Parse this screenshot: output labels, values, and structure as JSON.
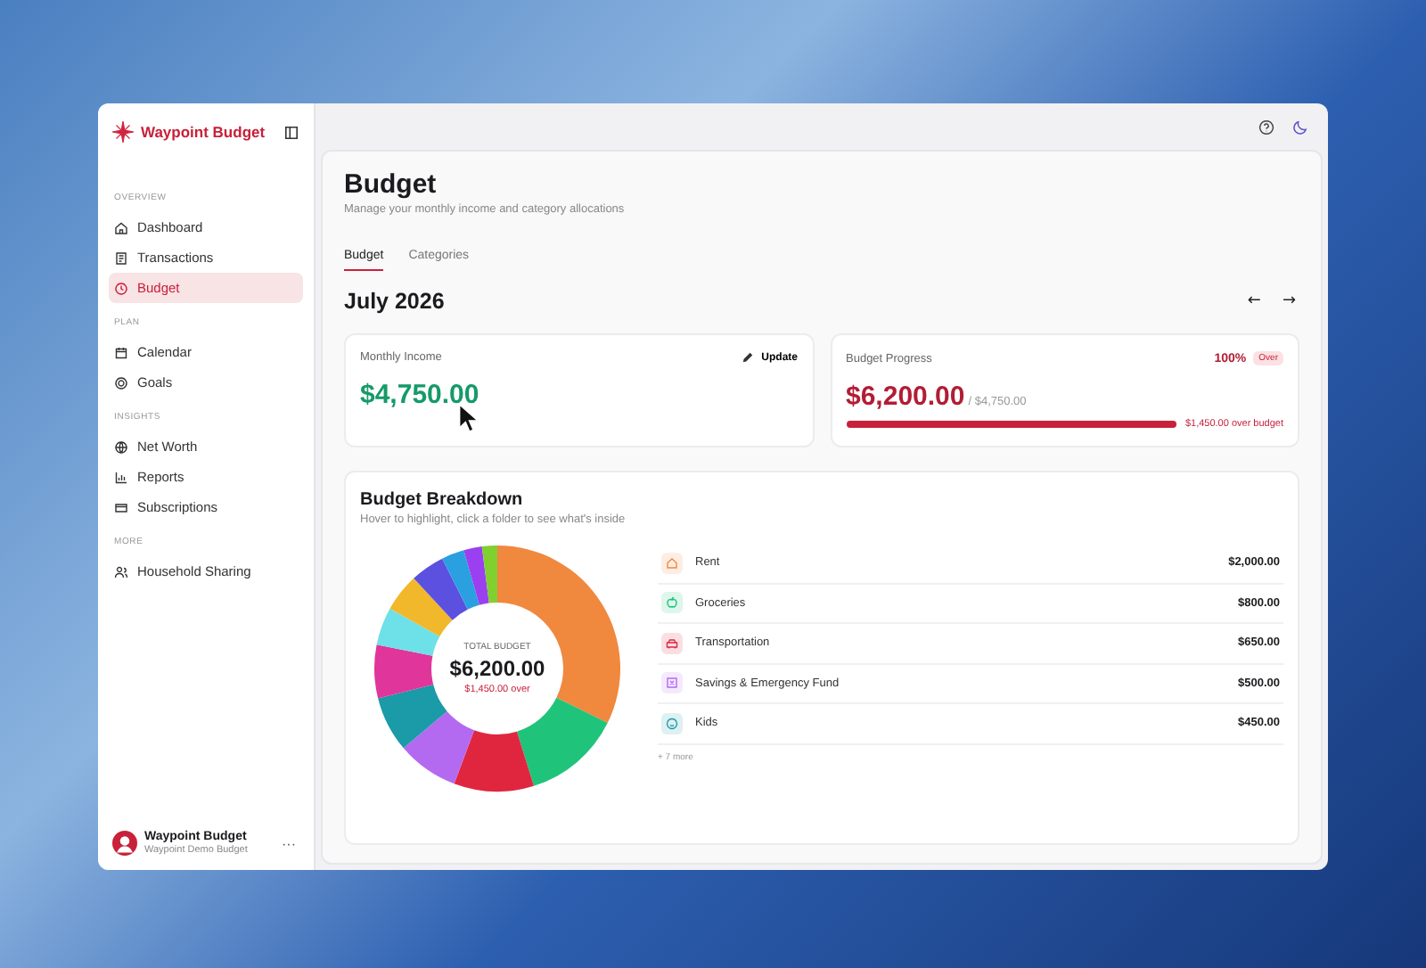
{
  "app": {
    "name": "Waypoint Budget"
  },
  "sidebar": {
    "sections": [
      {
        "heading": "OVERVIEW",
        "items": [
          {
            "label": "Dashboard",
            "selected": false
          },
          {
            "label": "Transactions",
            "selected": false
          },
          {
            "label": "Budget",
            "selected": true
          }
        ]
      },
      {
        "heading": "PLAN",
        "items": [
          {
            "label": "Calendar",
            "selected": false
          },
          {
            "label": "Goals",
            "selected": false
          }
        ]
      },
      {
        "heading": "INSIGHTS",
        "items": [
          {
            "label": "Net Worth",
            "selected": false
          },
          {
            "label": "Reports",
            "selected": false
          },
          {
            "label": "Subscriptions",
            "selected": false
          }
        ]
      },
      {
        "heading": "MORE",
        "items": [
          {
            "label": "Household Sharing",
            "selected": false
          }
        ]
      }
    ]
  },
  "account": {
    "name": "Waypoint Budget",
    "subtitle": "Waypoint Demo Budget",
    "menu": "···"
  },
  "page": {
    "title": "Budget",
    "subtitle": "Manage your monthly income and category allocations"
  },
  "tabs": [
    {
      "label": "Budget",
      "selected": true
    },
    {
      "label": "Categories",
      "selected": false
    }
  ],
  "month": {
    "label": "July 2026",
    "prev": "←",
    "next": "→"
  },
  "income_card": {
    "label": "Monthly Income",
    "button": "Update",
    "amount": "$4,750.00"
  },
  "progress_card": {
    "label": "Budget Progress",
    "percent": "100%",
    "badge": "Over",
    "spent": "$6,200.00",
    "of": "/ $4,750.00",
    "level": 1,
    "note": "$1,450.00 over budget"
  },
  "breakdown": {
    "title": "Budget Breakdown",
    "subtitle": "Hover to highlight, click a folder to see what's inside",
    "center_label": "TOTAL BUDGET",
    "center_amount": "$6,200.00",
    "center_note": "$1,450.00 over",
    "categories": [
      {
        "name": "Rent",
        "amount": "$2,000.00",
        "color": "#f0883e"
      },
      {
        "name": "Groceries",
        "amount": "$800.00",
        "color": "#1fc47a"
      },
      {
        "name": "Transportation",
        "amount": "$650.00",
        "color": "#e0263f"
      },
      {
        "name": "Savings & Emergency Fund",
        "amount": "$500.00",
        "color": "#b36af0"
      },
      {
        "name": "Kids",
        "amount": "$450.00",
        "color": "#1b9aa8"
      }
    ],
    "more": "+ 7 more"
  }
}
